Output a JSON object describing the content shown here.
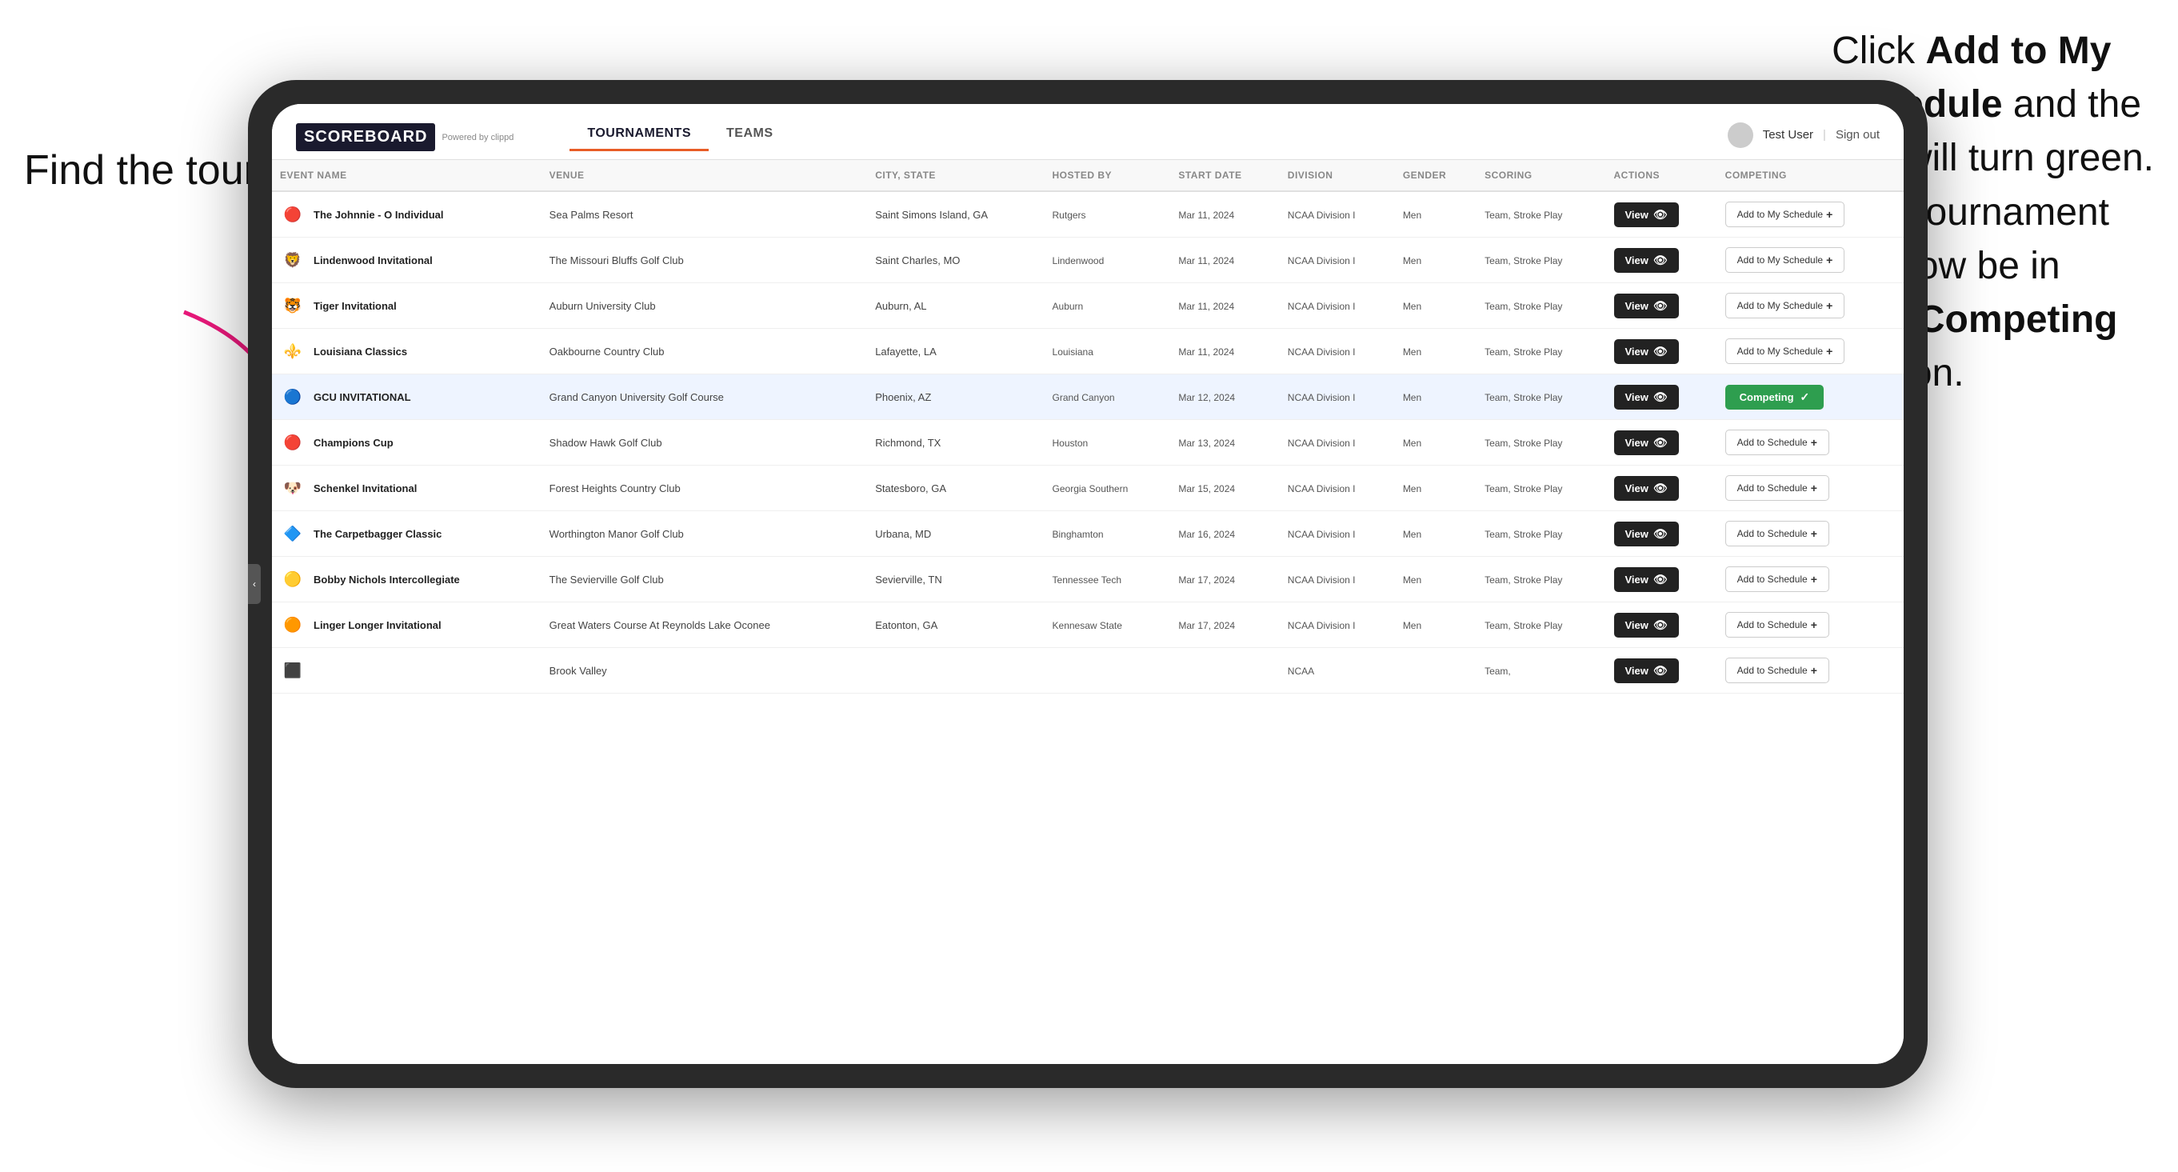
{
  "annotations": {
    "left": "Find the\ntournament.",
    "right_line1": "Click ",
    "right_bold1": "Add to My\nSchedule",
    "right_line2": " and the\nbox will turn green.\nThis tournament\nwill now be in\nyour ",
    "right_bold2": "Competing",
    "right_line3": "\nsection."
  },
  "header": {
    "logo": "SCOREBOARD",
    "logo_sub": "Powered by clippd",
    "tabs": [
      "TOURNAMENTS",
      "TEAMS"
    ],
    "active_tab": "TOURNAMENTS",
    "user": "Test User",
    "signout": "Sign out"
  },
  "table": {
    "columns": [
      "EVENT NAME",
      "VENUE",
      "CITY, STATE",
      "HOSTED BY",
      "START DATE",
      "DIVISION",
      "GENDER",
      "SCORING",
      "ACTIONS",
      "COMPETING"
    ],
    "rows": [
      {
        "logo": "🔴",
        "event": "The Johnnie - O Individual",
        "venue": "Sea Palms Resort",
        "city": "Saint Simons Island, GA",
        "host": "Rutgers",
        "date": "Mar 11, 2024",
        "division": "NCAA Division I",
        "gender": "Men",
        "scoring": "Team, Stroke Play",
        "action": "View",
        "competing": "Add to My Schedule",
        "highlighted": false
      },
      {
        "logo": "🦁",
        "event": "Lindenwood Invitational",
        "venue": "The Missouri Bluffs Golf Club",
        "city": "Saint Charles, MO",
        "host": "Lindenwood",
        "date": "Mar 11, 2024",
        "division": "NCAA Division I",
        "gender": "Men",
        "scoring": "Team, Stroke Play",
        "action": "View",
        "competing": "Add to My Schedule",
        "highlighted": false
      },
      {
        "logo": "🐯",
        "event": "Tiger Invitational",
        "venue": "Auburn University Club",
        "city": "Auburn, AL",
        "host": "Auburn",
        "date": "Mar 11, 2024",
        "division": "NCAA Division I",
        "gender": "Men",
        "scoring": "Team, Stroke Play",
        "action": "View",
        "competing": "Add to My Schedule",
        "highlighted": false
      },
      {
        "logo": "⚜️",
        "event": "Louisiana Classics",
        "venue": "Oakbourne Country Club",
        "city": "Lafayette, LA",
        "host": "Louisiana",
        "date": "Mar 11, 2024",
        "division": "NCAA Division I",
        "gender": "Men",
        "scoring": "Team, Stroke Play",
        "action": "View",
        "competing": "Add to My Schedule",
        "highlighted": false
      },
      {
        "logo": "🔵",
        "event": "GCU INVITATIONAL",
        "venue": "Grand Canyon University Golf Course",
        "city": "Phoenix, AZ",
        "host": "Grand Canyon",
        "date": "Mar 12, 2024",
        "division": "NCAA Division I",
        "gender": "Men",
        "scoring": "Team, Stroke Play",
        "action": "View",
        "competing": "Competing",
        "highlighted": true
      },
      {
        "logo": "🔴",
        "event": "Champions Cup",
        "venue": "Shadow Hawk Golf Club",
        "city": "Richmond, TX",
        "host": "Houston",
        "date": "Mar 13, 2024",
        "division": "NCAA Division I",
        "gender": "Men",
        "scoring": "Team, Stroke Play",
        "action": "View",
        "competing": "Add to Schedule",
        "highlighted": false
      },
      {
        "logo": "🐶",
        "event": "Schenkel Invitational",
        "venue": "Forest Heights Country Club",
        "city": "Statesboro, GA",
        "host": "Georgia Southern",
        "date": "Mar 15, 2024",
        "division": "NCAA Division I",
        "gender": "Men",
        "scoring": "Team, Stroke Play",
        "action": "View",
        "competing": "Add to Schedule",
        "highlighted": false
      },
      {
        "logo": "🔷",
        "event": "The Carpetbagger Classic",
        "venue": "Worthington Manor Golf Club",
        "city": "Urbana, MD",
        "host": "Binghamton",
        "date": "Mar 16, 2024",
        "division": "NCAA Division I",
        "gender": "Men",
        "scoring": "Team, Stroke Play",
        "action": "View",
        "competing": "Add to Schedule",
        "highlighted": false
      },
      {
        "logo": "🟡",
        "event": "Bobby Nichols Intercollegiate",
        "venue": "The Sevierville Golf Club",
        "city": "Sevierville, TN",
        "host": "Tennessee Tech",
        "date": "Mar 17, 2024",
        "division": "NCAA Division I",
        "gender": "Men",
        "scoring": "Team, Stroke Play",
        "action": "View",
        "competing": "Add to Schedule",
        "highlighted": false
      },
      {
        "logo": "🟠",
        "event": "Linger Longer Invitational",
        "venue": "Great Waters Course At Reynolds Lake Oconee",
        "city": "Eatonton, GA",
        "host": "Kennesaw State",
        "date": "Mar 17, 2024",
        "division": "NCAA Division I",
        "gender": "Men",
        "scoring": "Team, Stroke Play",
        "action": "View",
        "competing": "Add to Schedule",
        "highlighted": false
      },
      {
        "logo": "⬛",
        "event": "",
        "venue": "Brook Valley",
        "city": "",
        "host": "",
        "date": "",
        "division": "NCAA",
        "gender": "",
        "scoring": "Team,",
        "action": "View",
        "competing": "Add to Schedule",
        "highlighted": false
      }
    ]
  }
}
